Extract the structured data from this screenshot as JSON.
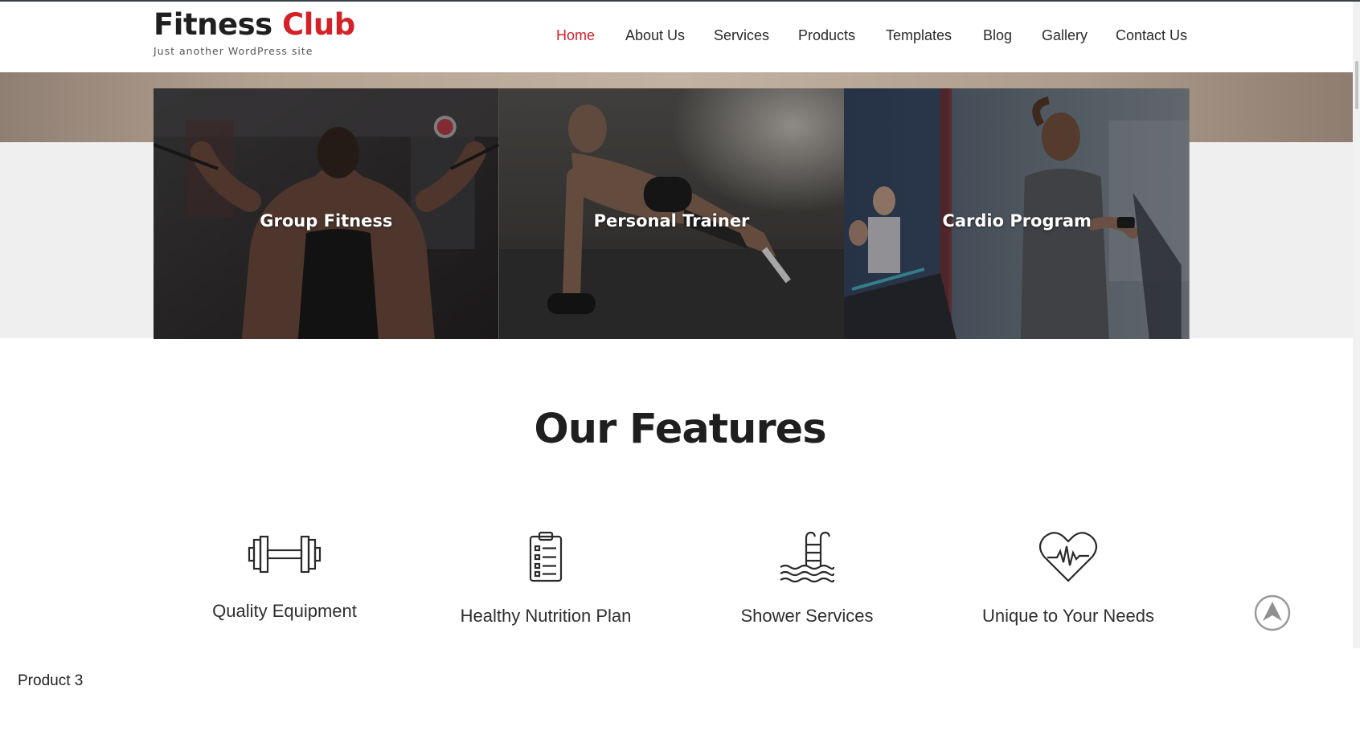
{
  "site": {
    "title_main": "Fitness",
    "title_accent": "Club",
    "tagline": "Just another WordPress site",
    "accent_color": "#d42027"
  },
  "nav": {
    "items": [
      {
        "label": "Home",
        "active": true
      },
      {
        "label": "About Us"
      },
      {
        "label": "Services"
      },
      {
        "label": "Products"
      },
      {
        "label": "Templates"
      },
      {
        "label": "Blog"
      },
      {
        "label": "Gallery"
      },
      {
        "label": "Contact Us"
      }
    ]
  },
  "hero": {
    "tiles": [
      {
        "caption": "Group Fitness"
      },
      {
        "caption": "Personal Trainer"
      },
      {
        "caption": "Cardio Program"
      }
    ]
  },
  "features": {
    "title": "Our Features",
    "items": [
      {
        "label": "Quality Equipment",
        "icon": "dumbbell-icon"
      },
      {
        "label": "Healthy Nutrition Plan",
        "icon": "clipboard-icon"
      },
      {
        "label": "Shower Services",
        "icon": "pool-ladder-icon"
      },
      {
        "label": "Unique to Your Needs",
        "icon": "heart-pulse-icon"
      }
    ]
  },
  "back_to_top": {
    "icon": "arrow-up-icon"
  },
  "footer_text": "Product 3"
}
